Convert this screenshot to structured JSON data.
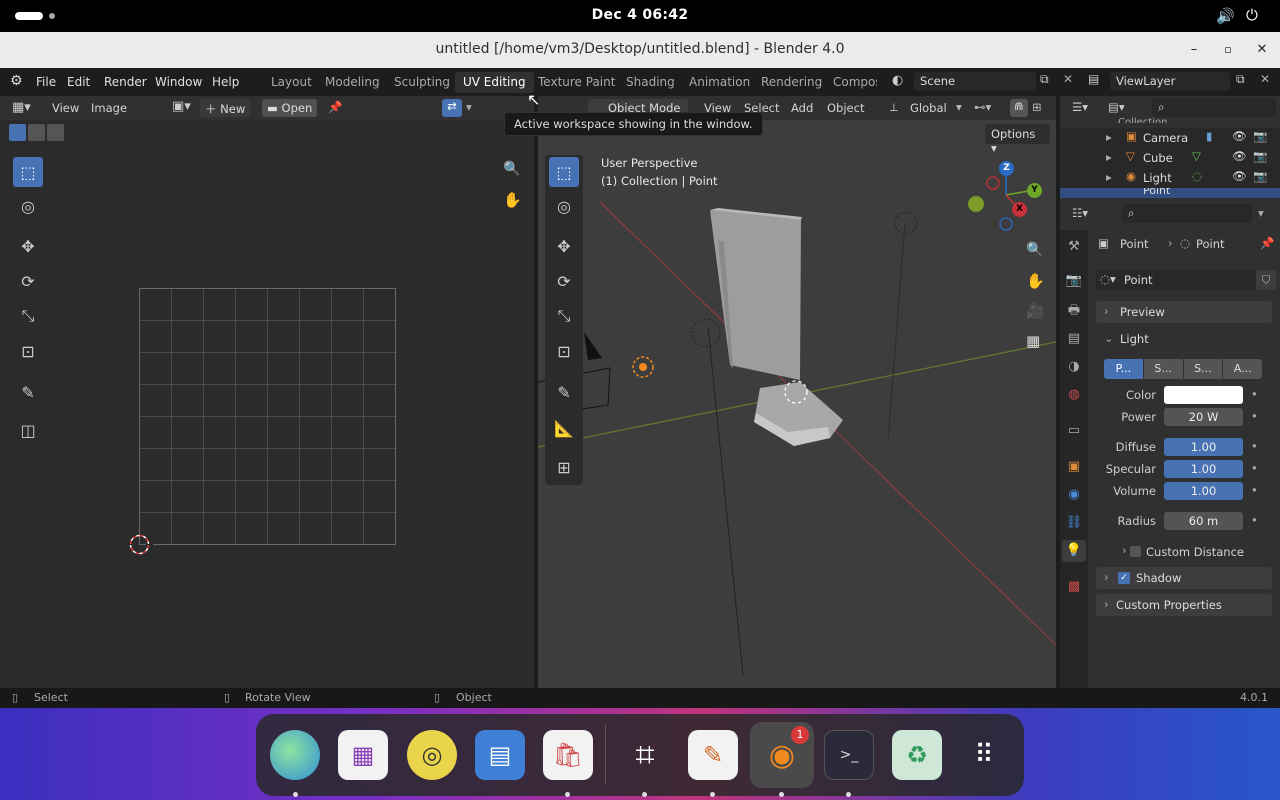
{
  "topbar": {
    "clock": "Dec 4  06:42",
    "speaker_icon": "speaker-icon",
    "power_icon": "power-icon"
  },
  "window": {
    "title": "untitled [/home/vm3/Desktop/untitled.blend] - Blender 4.0",
    "minimize": "–",
    "maximize": "▫",
    "close": "✕"
  },
  "menubar": {
    "items": [
      "File",
      "Edit",
      "Render",
      "Window",
      "Help"
    ],
    "workspaces": [
      "Layout",
      "Modeling",
      "Sculpting",
      "UV Editing",
      "Texture Paint",
      "Shading",
      "Animation",
      "Rendering",
      "Compos"
    ],
    "active_workspace": "UV Editing",
    "scene": "Scene",
    "view_layer": "ViewLayer"
  },
  "tooltip": "Active workspace showing in the window.",
  "uv_editor": {
    "view": "View",
    "image": "Image",
    "new": "New",
    "open": "Open"
  },
  "viewport": {
    "object_mode": "Object Mode",
    "view": "View",
    "select": "Select",
    "add": "Add",
    "object": "Object",
    "orientation": "Global",
    "options": "Options",
    "perspective": "User Perspective",
    "collection": "(1) Collection | Point",
    "gizmo": {
      "z": "Z",
      "y": "Y",
      "x": "X"
    }
  },
  "outliner": {
    "collection": "Collection",
    "items": [
      "Camera",
      "Cube",
      "Light",
      "Point"
    ]
  },
  "properties": {
    "breadcrumb_a": "Point",
    "breadcrumb_b": "Point",
    "datablock": "Point",
    "panel_preview": "Preview",
    "panel_light": "Light",
    "light_types": [
      "P...",
      "S...",
      "S...",
      "A..."
    ],
    "color_label": "Color",
    "power_label": "Power",
    "power_value": "20 W",
    "diffuse_label": "Diffuse",
    "diffuse_value": "1.00",
    "specular_label": "Specular",
    "specular_value": "1.00",
    "volume_label": "Volume",
    "volume_value": "1.00",
    "radius_label": "Radius",
    "radius_value": "60 m",
    "custom_distance": "Custom Distance",
    "shadow": "Shadow",
    "custom_properties": "Custom Properties"
  },
  "status": {
    "select": "Select",
    "rotate": "Rotate View",
    "object": "Object",
    "version": "4.0.1"
  },
  "dock": {
    "badge": "1"
  },
  "colors": {
    "accent": "#4772b3",
    "header": "#1d1d1d",
    "panel": "#303030",
    "viewport": "#3d3d3d"
  }
}
